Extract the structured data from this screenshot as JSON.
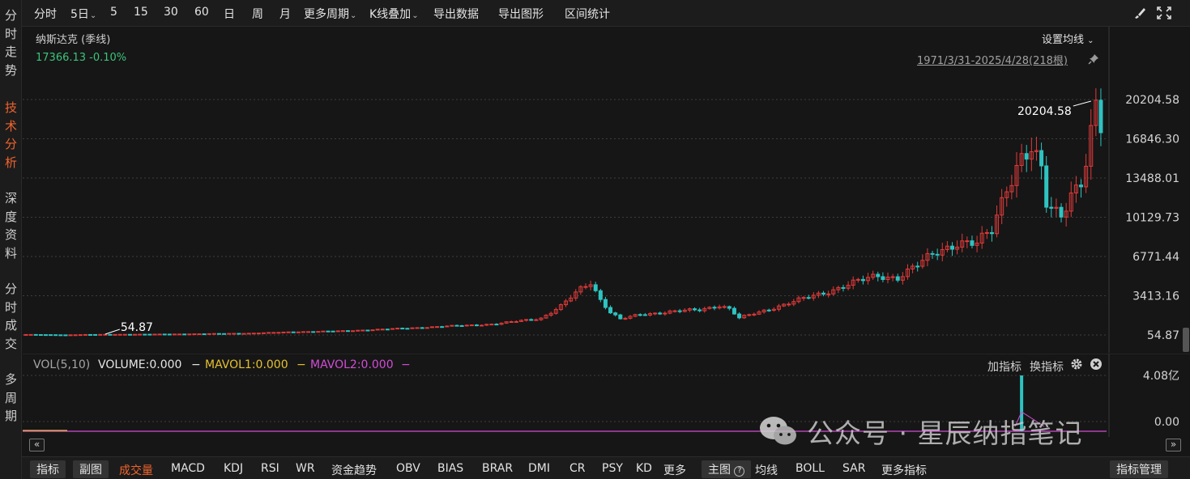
{
  "left_nav": [
    {
      "label": "分时走势",
      "active": false
    },
    {
      "label": "技术分析",
      "active": true
    },
    {
      "label": "深度资料",
      "active": false
    },
    {
      "label": "分时成交",
      "active": false
    },
    {
      "label": "多周期",
      "active": false
    }
  ],
  "toolbar": {
    "periods": [
      "分时",
      "5日",
      "5",
      "15",
      "30",
      "60",
      "日",
      "周",
      "月"
    ],
    "more_periods": "更多周期",
    "overlay": "K线叠加",
    "export_data": "导出数据",
    "export_chart": "导出图形",
    "range_stats": "区间统计",
    "icons": [
      "brush-icon",
      "fullscreen-icon"
    ]
  },
  "header": {
    "name": "纳斯达克 (季线)",
    "price": "17366.13",
    "change": "-0.10%",
    "ma_settings": "设置均线",
    "range_text": "1971/3/31-2025/4/28(218根)"
  },
  "chart_data": {
    "type": "candlestick",
    "period": "quarterly",
    "x_range": [
      "1971/3/31",
      "2025/4/28"
    ],
    "bar_count": 218,
    "last_close": 17366.13,
    "y_ticks": [
      20204.58,
      16846.3,
      13488.01,
      10129.73,
      6771.44,
      3413.16,
      54.87
    ],
    "ylim": [
      54.87,
      20204.58
    ],
    "grid": true,
    "annotations": [
      {
        "label": "20204.58",
        "value": 20204.58,
        "kind": "max"
      },
      {
        "label": "54.87",
        "value": 54.87,
        "kind": "min"
      }
    ],
    "anchors": [
      [
        0,
        95
      ],
      [
        8,
        60
      ],
      [
        12,
        90
      ],
      [
        30,
        130
      ],
      [
        45,
        200
      ],
      [
        55,
        330
      ],
      [
        64,
        400
      ],
      [
        75,
        600
      ],
      [
        85,
        800
      ],
      [
        95,
        1000
      ],
      [
        104,
        1500
      ],
      [
        108,
        2500
      ],
      [
        112,
        4000
      ],
      [
        114,
        4600
      ],
      [
        116,
        3100
      ],
      [
        118,
        2000
      ],
      [
        120,
        1400
      ],
      [
        124,
        1800
      ],
      [
        130,
        2050
      ],
      [
        136,
        2200
      ],
      [
        140,
        2600
      ],
      [
        142,
        2300
      ],
      [
        144,
        1500
      ],
      [
        148,
        2000
      ],
      [
        154,
        2800
      ],
      [
        160,
        3500
      ],
      [
        166,
        4400
      ],
      [
        172,
        5100
      ],
      [
        176,
        5000
      ],
      [
        180,
        6000
      ],
      [
        184,
        7200
      ],
      [
        188,
        8000
      ],
      [
        192,
        7800
      ],
      [
        195,
        9000
      ],
      [
        198,
        12900
      ],
      [
        201,
        15300
      ],
      [
        203,
        15700
      ],
      [
        205,
        14000
      ],
      [
        206,
        11200
      ],
      [
        207,
        10800
      ],
      [
        209,
        10500
      ],
      [
        211,
        12300
      ],
      [
        213,
        13200
      ],
      [
        214,
        14700
      ],
      [
        215,
        17000
      ],
      [
        216,
        19300
      ],
      [
        217,
        17366
      ]
    ],
    "volume": {
      "title": "VOL(5,10)",
      "volume_label": "VOLUME:0.000",
      "mavol1_label": "MAVOL1:0.000",
      "mavol2_label": "MAVOL2:0.000",
      "y_ticks": [
        "4.08亿",
        "0.00"
      ],
      "spike_bar_index": 201,
      "spike_value_label": "4.08亿"
    }
  },
  "vol_tools": {
    "add": "加指标",
    "switch": "换指标"
  },
  "bottom_bar": {
    "indicators_btn": "指标",
    "sub_chart_btn": "副图",
    "items": [
      "成交量",
      "MACD",
      "KDJ",
      "RSI",
      "WR",
      "资金趋势",
      "OBV",
      "BIAS",
      "BRAR",
      "DMI",
      "CR",
      "PSY",
      "KD",
      "更多"
    ],
    "active_item": "成交量",
    "main_chart_btn": "主图",
    "main_items": [
      "均线",
      "BOLL",
      "SAR",
      "更多指标"
    ],
    "manage_btn": "指标管理"
  },
  "watermark": {
    "text": "公众号 · 星辰纳指笔记"
  },
  "colors": {
    "up": "#e13a3a",
    "down": "#2ec3c1",
    "accent": "#f0642d",
    "price_green": "#3cc47a",
    "mavol1": "#e5c12f",
    "mavol2": "#d24dd6"
  }
}
